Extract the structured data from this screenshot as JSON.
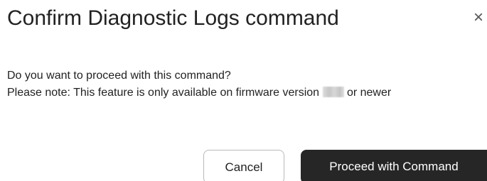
{
  "dialog": {
    "title": "Confirm Diagnostic Logs command",
    "close_icon": "×",
    "message_line1": "Do you want to proceed with this command?",
    "message_line2_prefix": "Please note: This feature is only available on firmware version",
    "message_line2_suffix": "or newer",
    "cancel_label": "Cancel",
    "proceed_label": "Proceed with Command"
  }
}
